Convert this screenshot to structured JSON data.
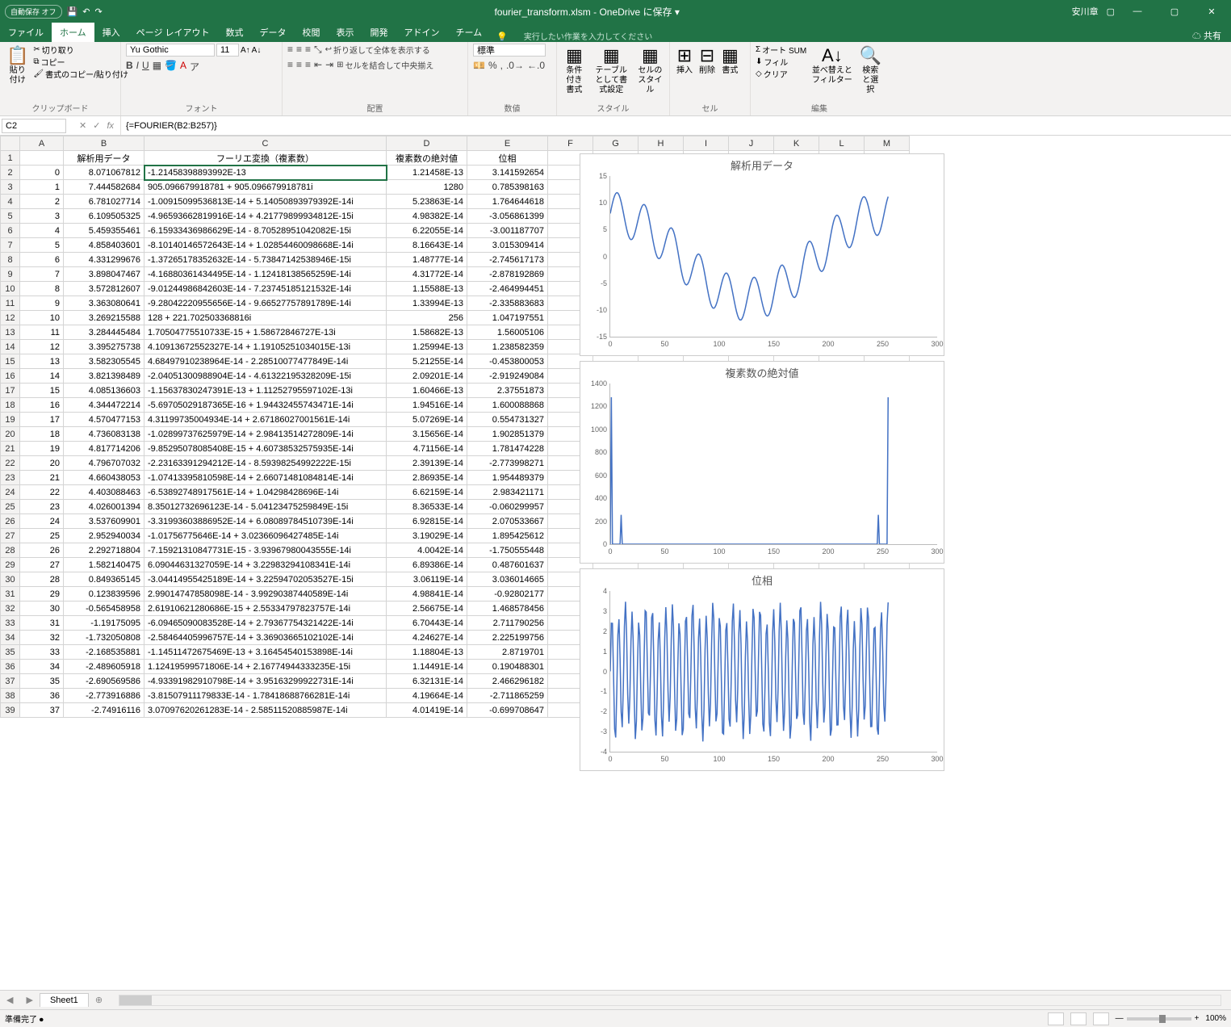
{
  "titlebar": {
    "autosave_label": "自動保存",
    "autosave_state": "オフ",
    "filename": "fourier_transform.xlsm - OneDrive に保存 ▾",
    "user": "安川章"
  },
  "tabs": {
    "items": [
      "ファイル",
      "ホーム",
      "挿入",
      "ページ レイアウト",
      "数式",
      "データ",
      "校閲",
      "表示",
      "開発",
      "アドイン",
      "チーム"
    ],
    "active_index": 1,
    "tell_me": "実行したい作業を入力してください",
    "share": "共有"
  },
  "ribbon": {
    "clipboard": {
      "paste": "貼り付け",
      "cut": "切り取り",
      "copy": "コピー",
      "format_painter": "書式のコピー/貼り付け",
      "label": "クリップボード"
    },
    "font": {
      "name": "Yu Gothic",
      "size": "11",
      "label": "フォント"
    },
    "align": {
      "wrap": "折り返して全体を表示する",
      "merge": "セルを結合して中央揃え",
      "label": "配置"
    },
    "number": {
      "format": "標準",
      "label": "数値"
    },
    "styles": {
      "cond": "条件付き書式",
      "table": "テーブルとして書式設定",
      "cell": "セルのスタイル",
      "label": "スタイル"
    },
    "cells": {
      "insert": "挿入",
      "delete": "削除",
      "format": "書式",
      "label": "セル"
    },
    "editing": {
      "autosum": "オート SUM",
      "fill": "フィル",
      "clear": "クリア",
      "sort": "並べ替えとフィルター",
      "find": "検索と選択",
      "label": "編集"
    }
  },
  "fx": {
    "cell": "C2",
    "formula": "{=FOURIER(B2:B257)}"
  },
  "columns": [
    "A",
    "B",
    "C",
    "D",
    "E",
    "F",
    "G",
    "H",
    "I",
    "J",
    "K",
    "L",
    "M"
  ],
  "headers": {
    "A": "",
    "B": "解析用データ",
    "C": "フーリエ変換（複素数）",
    "D": "複素数の絶対値",
    "E": "位相"
  },
  "rows": [
    {
      "r": 2,
      "A": "0",
      "B": "8.071067812",
      "C": "-1.21458398893992E-13",
      "D": "1.21458E-13",
      "E": "3.141592654"
    },
    {
      "r": 3,
      "A": "1",
      "B": "7.444582684",
      "C": "905.096679918781 + 905.096679918781i",
      "D": "1280",
      "E": "0.785398163"
    },
    {
      "r": 4,
      "A": "2",
      "B": "6.781027714",
      "C": "-1.00915099536813E-14 + 5.14050893979392E-14i",
      "D": "5.23863E-14",
      "E": "1.764644618"
    },
    {
      "r": 5,
      "A": "3",
      "B": "6.109505325",
      "C": "-4.96593662819916E-14 + 4.21779899934812E-15i",
      "D": "4.98382E-14",
      "E": "-3.056861399"
    },
    {
      "r": 6,
      "A": "4",
      "B": "5.459355461",
      "C": "-6.15933436986629E-14 - 8.70528951042082E-15i",
      "D": "6.22055E-14",
      "E": "-3.001187707"
    },
    {
      "r": 7,
      "A": "5",
      "B": "4.858403601",
      "C": "-8.10140146572643E-14 + 1.02854460098668E-14i",
      "D": "8.16643E-14",
      "E": "3.015309414"
    },
    {
      "r": 8,
      "A": "6",
      "B": "4.331299676",
      "C": "-1.37265178352632E-14 - 5.73847142538946E-15i",
      "D": "1.48777E-14",
      "E": "-2.745617173"
    },
    {
      "r": 9,
      "A": "7",
      "B": "3.898047467",
      "C": "-4.16880361434495E-14 - 1.12418138565259E-14i",
      "D": "4.31772E-14",
      "E": "-2.878192869"
    },
    {
      "r": 10,
      "A": "8",
      "B": "3.572812607",
      "C": "-9.01244986842603E-14 - 7.23745185121532E-14i",
      "D": "1.15588E-13",
      "E": "-2.464994451"
    },
    {
      "r": 11,
      "A": "9",
      "B": "3.363080641",
      "C": "-9.28042220955656E-14 - 9.66527757891789E-14i",
      "D": "1.33994E-13",
      "E": "-2.335883683"
    },
    {
      "r": 12,
      "A": "10",
      "B": "3.269215588",
      "C": "128 + 221.702503368816i",
      "D": "256",
      "E": "1.047197551"
    },
    {
      "r": 13,
      "A": "11",
      "B": "3.284445484",
      "C": "1.70504775510733E-15 + 1.58672846727E-13i",
      "D": "1.58682E-13",
      "E": "1.56005106"
    },
    {
      "r": 14,
      "A": "12",
      "B": "3.395275738",
      "C": "4.10913672552327E-14 + 1.19105251034015E-13i",
      "D": "1.25994E-13",
      "E": "1.238582359"
    },
    {
      "r": 15,
      "A": "13",
      "B": "3.582305545",
      "C": "4.68497910238964E-14 - 2.28510077477849E-14i",
      "D": "5.21255E-14",
      "E": "-0.453800053"
    },
    {
      "r": 16,
      "A": "14",
      "B": "3.821398489",
      "C": "-2.04051300988904E-14 - 4.61322195328209E-15i",
      "D": "2.09201E-14",
      "E": "-2.919249084"
    },
    {
      "r": 17,
      "A": "15",
      "B": "4.085136603",
      "C": "-1.15637830247391E-13 + 1.11252795597102E-13i",
      "D": "1.60466E-13",
      "E": "2.37551873"
    },
    {
      "r": 18,
      "A": "16",
      "B": "4.344472214",
      "C": "-5.69705029187365E-16 + 1.94432455743471E-14i",
      "D": "1.94516E-14",
      "E": "1.600088868"
    },
    {
      "r": 19,
      "A": "17",
      "B": "4.570477153",
      "C": "4.31199735004934E-14 + 2.67186027001561E-14i",
      "D": "5.07269E-14",
      "E": "0.554731327"
    },
    {
      "r": 20,
      "A": "18",
      "B": "4.736083138",
      "C": "-1.02899737625979E-14 + 2.98413514272809E-14i",
      "D": "3.15656E-14",
      "E": "1.902851379"
    },
    {
      "r": 21,
      "A": "19",
      "B": "4.817714206",
      "C": "-9.85295078085408E-15 + 4.60738532575935E-14i",
      "D": "4.71156E-14",
      "E": "1.781474228"
    },
    {
      "r": 22,
      "A": "20",
      "B": "4.796707032",
      "C": "-2.23163391294212E-14 - 8.59398254992222E-15i",
      "D": "2.39139E-14",
      "E": "-2.773998271"
    },
    {
      "r": 23,
      "A": "21",
      "B": "4.660438053",
      "C": "-1.07413395810598E-14 + 2.66071481084814E-14i",
      "D": "2.86935E-14",
      "E": "1.954489379"
    },
    {
      "r": 24,
      "A": "22",
      "B": "4.403088463",
      "C": "-6.53892748917561E-14 + 1.04298428696E-14i",
      "D": "6.62159E-14",
      "E": "2.983421171"
    },
    {
      "r": 25,
      "A": "23",
      "B": "4.026001394",
      "C": "8.35012732696123E-14 - 5.04123475259849E-15i",
      "D": "8.36533E-14",
      "E": "-0.060299957"
    },
    {
      "r": 26,
      "A": "24",
      "B": "3.537609901",
      "C": "-3.31993603886952E-14 + 6.08089784510739E-14i",
      "D": "6.92815E-14",
      "E": "2.070533667"
    },
    {
      "r": 27,
      "A": "25",
      "B": "2.952940034",
      "C": "-1.01756775646E-14 + 3.02366096427485E-14i",
      "D": "3.19029E-14",
      "E": "1.895425612"
    },
    {
      "r": 28,
      "A": "26",
      "B": "2.292718804",
      "C": "-7.15921310847731E-15 - 3.93967980043555E-14i",
      "D": "4.0042E-14",
      "E": "-1.750555448"
    },
    {
      "r": 29,
      "A": "27",
      "B": "1.582140475",
      "C": "6.09044631327059E-14 + 3.22983294108341E-14i",
      "D": "6.89386E-14",
      "E": "0.487601637"
    },
    {
      "r": 30,
      "A": "28",
      "B": "0.849365145",
      "C": "-3.04414955425189E-14 + 3.22594702053527E-15i",
      "D": "3.06119E-14",
      "E": "3.036014665"
    },
    {
      "r": 31,
      "A": "29",
      "B": "0.123839596",
      "C": "2.99014747858098E-14 - 3.99290387440589E-14i",
      "D": "4.98841E-14",
      "E": "-0.92802177"
    },
    {
      "r": 32,
      "A": "30",
      "B": "-0.565458958",
      "C": "2.61910621280686E-15 + 2.55334797823757E-14i",
      "D": "2.56675E-14",
      "E": "1.468578456"
    },
    {
      "r": 33,
      "A": "31",
      "B": "-1.19175095",
      "C": "-6.09465090083528E-14 + 2.79367754321422E-14i",
      "D": "6.70443E-14",
      "E": "2.711790256"
    },
    {
      "r": 34,
      "A": "32",
      "B": "-1.732050808",
      "C": "-2.58464405996757E-14 + 3.36903665102102E-14i",
      "D": "4.24627E-14",
      "E": "2.225199756"
    },
    {
      "r": 35,
      "A": "33",
      "B": "-2.168535881",
      "C": "-1.14511472675469E-13 + 3.16454540153898E-14i",
      "D": "1.18804E-13",
      "E": "2.8719701"
    },
    {
      "r": 36,
      "A": "34",
      "B": "-2.489605918",
      "C": "1.12419599571806E-14 + 2.16774944333235E-15i",
      "D": "1.14491E-14",
      "E": "0.190488301"
    },
    {
      "r": 37,
      "A": "35",
      "B": "-2.690569586",
      "C": "-4.93391982910798E-14 + 3.95163299922731E-14i",
      "D": "6.32131E-14",
      "E": "2.466296182"
    },
    {
      "r": 38,
      "A": "36",
      "B": "-2.773916886",
      "C": "-3.81507911179833E-14 - 1.78418688766281E-14i",
      "D": "4.19664E-14",
      "E": "-2.711865259"
    },
    {
      "r": 39,
      "A": "37",
      "B": "-2.74916116",
      "C": "3.07097620261283E-14 - 2.58511520885987E-14i",
      "D": "4.01419E-14",
      "E": "-0.699708647"
    }
  ],
  "sheet_tab": "Sheet1",
  "status": {
    "ready": "準備完了",
    "zoom": "100%"
  },
  "chart_data": {
    "accent": "#4472C4",
    "charts": [
      {
        "title": "解析用データ",
        "type": "line",
        "xlim": [
          0,
          300
        ],
        "xticks": [
          0,
          50,
          100,
          150,
          200,
          250,
          300
        ],
        "ylim": [
          -15,
          15
        ],
        "yticks": [
          -15,
          -10,
          -5,
          0,
          5,
          10,
          15
        ],
        "note": "256-point oscillating signal, amplitude gradually increasing from ~8 down to ~-12 and back to ~10; values approximate"
      },
      {
        "title": "複素数の絶対値",
        "type": "line",
        "xlim": [
          0,
          300
        ],
        "xticks": [
          0,
          50,
          100,
          150,
          200,
          250,
          300
        ],
        "ylim": [
          0,
          1400
        ],
        "yticks": [
          0,
          200,
          400,
          600,
          800,
          1000,
          1200,
          1400
        ],
        "peaks": [
          {
            "x": 1,
            "y": 1280
          },
          {
            "x": 10,
            "y": 256
          },
          {
            "x": 246,
            "y": 256
          },
          {
            "x": 255,
            "y": 1280
          }
        ],
        "baseline": 0
      },
      {
        "title": "位相",
        "type": "line",
        "xlim": [
          0,
          300
        ],
        "xticks": [
          0,
          50,
          100,
          150,
          200,
          250,
          300
        ],
        "ylim": [
          -4,
          4
        ],
        "yticks": [
          -4,
          -3,
          -2,
          -1,
          0,
          1,
          2,
          3,
          4
        ],
        "note": "dense noise-like oscillation between approximately -3.14 and 3.14"
      }
    ]
  }
}
